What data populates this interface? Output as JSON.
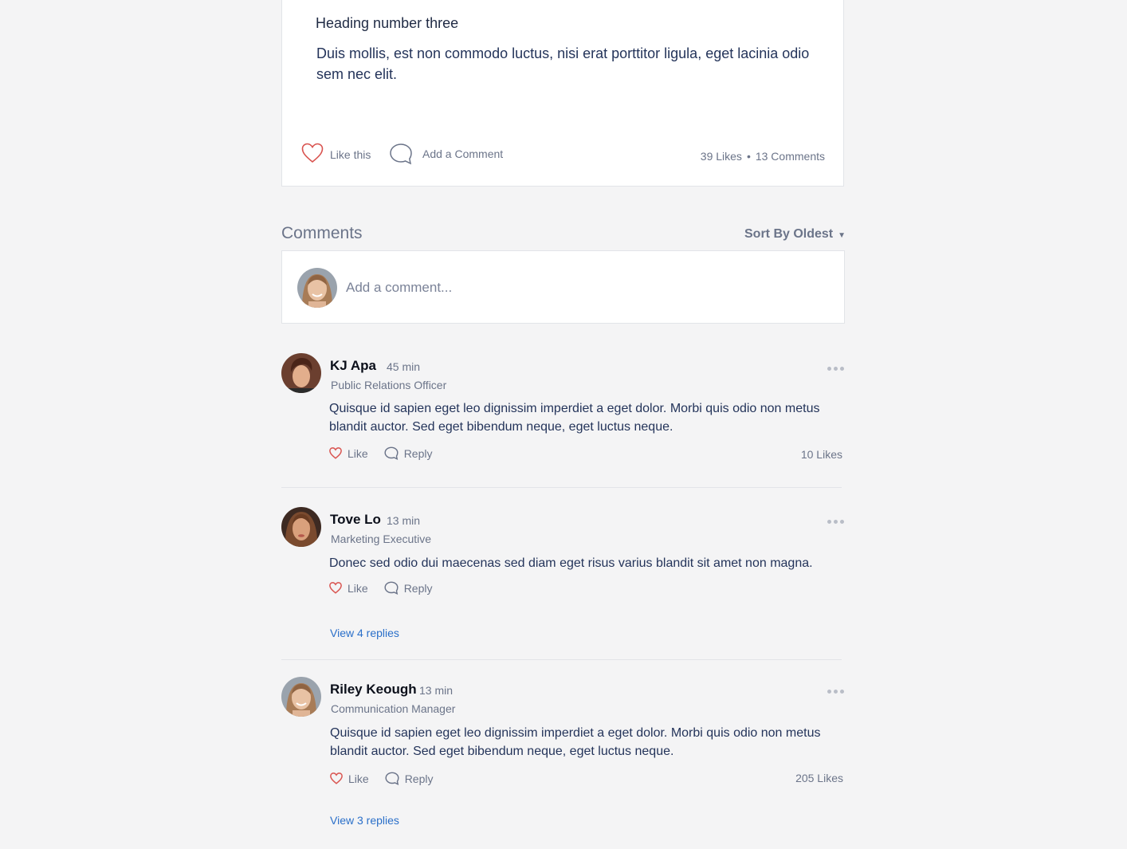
{
  "post": {
    "heading": "Heading number three",
    "body": "Duis mollis, est non commodo luctus, nisi erat porttitor ligula, eget lacinia odio sem nec elit.",
    "like_label": "Like this",
    "comment_label": "Add a Comment",
    "likes": "39 Likes",
    "separator": "•",
    "comments_count": "13 Comments"
  },
  "comments_section": {
    "title": "Comments",
    "sort_label": "Sort By Oldest",
    "sort_caret": "▼",
    "add_placeholder": "Add a comment..."
  },
  "comments": [
    {
      "name": "KJ Apa",
      "time": "45 min",
      "role": "Public Relations Officer",
      "text": "Quisque id sapien eget leo dignissim imperdiet a eget dolor. Morbi quis odio non metus blandit auctor. Sed eget bibendum neque, eget luctus neque.",
      "like_label": "Like",
      "reply_label": "Reply",
      "likes": "10 Likes"
    },
    {
      "name": "Tove Lo",
      "time": "13 min",
      "role": "Marketing Executive",
      "text": "Donec sed odio dui maecenas sed diam eget risus varius blandit sit amet non magna.",
      "like_label": "Like",
      "reply_label": "Reply",
      "view_replies": "View 4 replies"
    },
    {
      "name": "Riley Keough",
      "time": "13 min",
      "role": "Communication Manager",
      "text": "Quisque id sapien eget leo dignissim imperdiet a eget dolor. Morbi quis odio non metus blandit auctor. Sed eget bibendum neque, eget luctus neque.",
      "like_label": "Like",
      "reply_label": "Reply",
      "likes": "205 Likes",
      "view_replies": "View 3 replies"
    }
  ],
  "colors": {
    "background": "#f4f4f5",
    "heart": "#d9534f",
    "link": "#2a6fc9",
    "muted": "#6b7489"
  }
}
